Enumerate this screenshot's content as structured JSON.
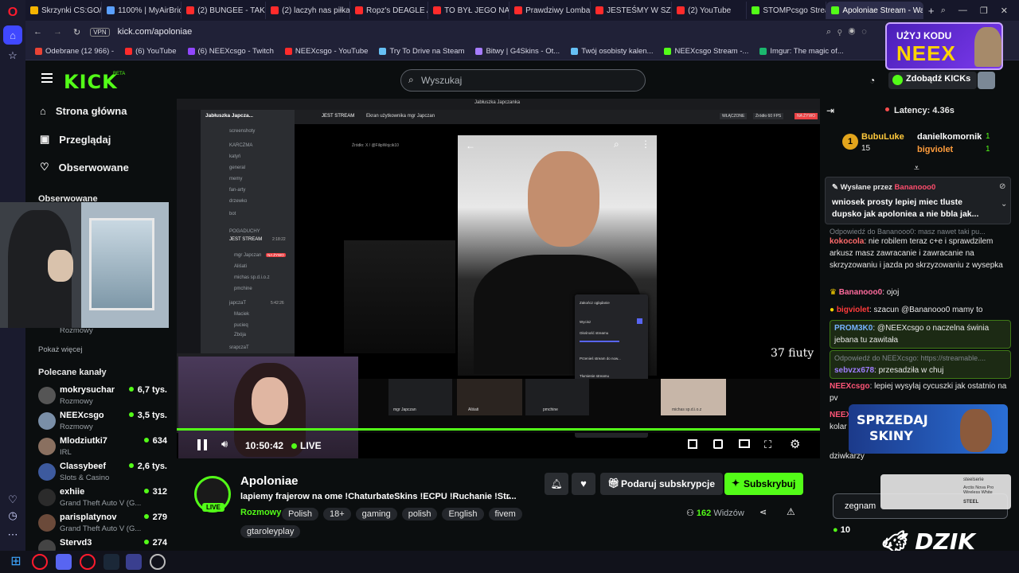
{
  "tabs": [
    {
      "label": "Skrzynki CS:GO/CS2 |",
      "color": "#f5b400"
    },
    {
      "label": "1100% | MyAirBridge",
      "color": "#5aa0ff"
    },
    {
      "label": "(2) BUNGEE - TAK",
      "color": "#ff2b2b"
    },
    {
      "label": "(2) laczyh nas piłka - Y",
      "color": "#ff2b2b"
    },
    {
      "label": "Ropz's DEAGLE Aim is",
      "color": "#ff2b2b"
    },
    {
      "label": "TO BYŁ JEGO NAJGOR",
      "color": "#ff2b2b"
    },
    {
      "label": "Prawdziwy Lombard -",
      "color": "#ff2b2b"
    },
    {
      "label": "JESTEŚMY W SZWECI",
      "color": "#ff2b2b"
    },
    {
      "label": "(2) YouTube",
      "color": "#ff2b2b"
    },
    {
      "label": "STOMPcsgo Stream",
      "color": "#53fc18"
    },
    {
      "label": "Apoloniae Stream - Watc",
      "color": "#53fc18"
    }
  ],
  "address": {
    "vpn": "VPN",
    "url": "kick.com/apoloniae"
  },
  "bookmarks": [
    {
      "label": "Odebrane (12 966) -",
      "color": "#ea4335"
    },
    {
      "label": "(6) YouTube",
      "color": "#ff2b2b"
    },
    {
      "label": "(6) NEEXcsgo - Twitch",
      "color": "#9146ff"
    },
    {
      "label": "NEEXcsgo - YouTube",
      "color": "#ff2b2b"
    },
    {
      "label": "Try To Drive na Steam",
      "color": "#66c0f4"
    },
    {
      "label": "Bitwy | G4Skins - Ot...",
      "color": "#a67cff"
    },
    {
      "label": "Twój osobisty kalen...",
      "color": "#66c0f4"
    },
    {
      "label": "NEEXcsgo Stream -...",
      "color": "#53fc18"
    },
    {
      "label": "Imgur: The magic of...",
      "color": "#1bb76e"
    }
  ],
  "header": {
    "logo": "KICK",
    "beta": "BETA",
    "search_placeholder": "Wyszukaj",
    "kicks_button": "Zdobądź KICKs"
  },
  "promo": {
    "top": "UŻYJ KODU",
    "code": "NEEX"
  },
  "sidebar": {
    "nav": [
      "Strona główna",
      "Przeglądaj",
      "Obserwowane"
    ],
    "following_title": "Obserwowane",
    "following_category": "Rozmowy",
    "show_more": "Pokaż więcej",
    "recommended_title": "Polecane kanały",
    "channels": [
      {
        "name": "mokrysuchar",
        "category": "Rozmowy",
        "viewers": "6,7 tys.",
        "color": "#555"
      },
      {
        "name": "NEEXcsgo",
        "category": "Rozmowy",
        "viewers": "3,5 tys.",
        "color": "#7a8fa8"
      },
      {
        "name": "Mlodziutki7",
        "category": "IRL",
        "viewers": "634",
        "color": "#8a7060"
      },
      {
        "name": "Classybeef",
        "category": "Slots & Casino",
        "viewers": "2,6 tys.",
        "color": "#3d5a9e"
      },
      {
        "name": "exhiie",
        "category": "Grand Theft Auto V (G...",
        "viewers": "312",
        "color": "#2b2b2b"
      },
      {
        "name": "parisplatynov",
        "category": "Grand Theft Auto V (G...",
        "viewers": "279",
        "color": "#6b4a3a"
      },
      {
        "name": "Stervd3",
        "category": "",
        "viewers": "274",
        "color": "#444"
      }
    ]
  },
  "discord": {
    "server": "Jabłuszka Japcza...",
    "channels": [
      "screenshoty",
      "KARCZMA",
      "katyń",
      "general",
      "memy",
      "fan-arty",
      "drzewko",
      "bot",
      "POGADUCHY",
      "JEST STREAM",
      "japczaT",
      "srapczaT"
    ],
    "voice_users": [
      "mgr Japczan",
      "Aliśati",
      "michas sp.d.i.o.z",
      "pmchine",
      "Maciek",
      "pucieq",
      "Zbója"
    ],
    "live_badge": "NA ŻYWO",
    "stream_title": "JEST STREAM",
    "stream_user": "Ekran użytkownika mgr Japczan",
    "top_title": "Jabłuszka Japczanka",
    "buttons": [
      "WŁĄCZONE",
      "Źródło 60 FPS",
      "NA ŻYWO"
    ],
    "source": "Źródło: X / @FilipWojcik10",
    "photo_caption": "37 fiuty",
    "menu": [
      "Zakończ oglądanie",
      "Wycisz",
      "Głośność streamu",
      "Przenieś stream do now...",
      "Tłumienie streamu",
      "Siła tłumienia streamu",
      "Więcej opcji"
    ],
    "menu_note": "Automatycznie zmniejsz poziom głośności transmisji, gdy osoby rozmawiają.",
    "tiles": [
      "mgr Japczan",
      "Aliśati",
      "pmchine",
      "michas sp.d.i.o.z"
    ],
    "stream_time": "2:18:22",
    "stream_time2": "5:42:26"
  },
  "controls": {
    "time": "10:50:42",
    "live": "LIVE"
  },
  "stream": {
    "channel": "Apoloniae",
    "title": "lapiemy frajerow na ome !ChaturbateSkins !ECPU !Ruchanie !Str...",
    "category": "Rozmowy",
    "tags": [
      "Polish",
      "18+",
      "gaming",
      "polish",
      "English",
      "fivem",
      "gtaroleyplay"
    ],
    "live_badge": "LIVE",
    "gift": "Podaruj subskrypcje",
    "subscribe": "Subskrybuj",
    "viewers": "162",
    "viewers_label": "Widzów"
  },
  "chat": {
    "latency": "Latency: 4.36s",
    "leader1": {
      "name": "BubuLuke",
      "count": "15"
    },
    "leader2": {
      "name": "danielkomornik",
      "count": "1"
    },
    "leader3": {
      "name": "bigviolet",
      "count": "1"
    },
    "pinned_by": "Wysłane przez",
    "pinned_user": "Bananooo0",
    "pinned_text": "wniosek prosty lepiej miec tluste dupsko jak apoloniea a nie bbla jak...",
    "messages": [
      {
        "reply": "Odpowiedź do Bananooo0: masz nawet taki pu...",
        "user": "kokocola",
        "color": "#ff6b6b",
        "text": "nie robilem teraz c+e i sprawdzilem arkusz masz zawracanie i zawracanie na skrzyzowaniu i jazda po skrzyzowaniu z wysepka"
      },
      {
        "user": "Bananooo0",
        "color": "#ff6b9d",
        "text": "ojoj"
      },
      {
        "user": "bigviolet",
        "color": "#ff3b3b",
        "text": "szacun @Bananooo0 mamy to"
      },
      {
        "user": "PROM3K0",
        "color": "#75b2ff",
        "text": "@NEEXcsgo o naczelna świnia jebana tu zawitała"
      },
      {
        "reply": "Odpowiedź do NEEXcsgo: https://streamable....",
        "user": "sebvzx678",
        "color": "#9f7dff",
        "text": "przesadziła w chuj"
      },
      {
        "user": "NEEXcsgo",
        "color": "#ff5577",
        "text": "lepiej wysylaj cycuszki jak ostatnio na pv"
      },
      {
        "user": "NEEX",
        "color": "#ff5577",
        "text": "kolar"
      },
      {
        "user": "",
        "color": "#ffffff",
        "text": "dziwkarzy"
      }
    ],
    "input_value": "zegnam",
    "points": "10"
  },
  "ads": {
    "skins_line1": "SPRZEDAJ",
    "skins_line2": "SKINY",
    "steelseries_brand": "steelserie",
    "steelseries_text": "Arctis Nova Pro Wireless White",
    "steelseries_logo": "STEEL",
    "dzik": "DZIK"
  }
}
